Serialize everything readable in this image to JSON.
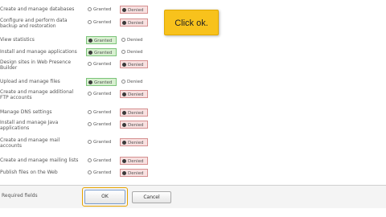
{
  "permissions": [
    {
      "label": "Create and manage databases",
      "granted": "Granted",
      "denied": "Denied",
      "selected": "denied"
    },
    {
      "label": "Configure and perform data\nbackup and restoration",
      "granted": "Granted",
      "denied": "Denied",
      "selected": "denied"
    },
    {
      "label": "View statistics",
      "granted": "Granted",
      "denied": "Denied",
      "selected": "granted"
    },
    {
      "label": "Install and manage applications",
      "granted": "Granted",
      "denied": "Denied",
      "selected": "granted"
    },
    {
      "label": "Design sites in Web Presence\nBuilder",
      "granted": "Granted",
      "denied": "Denied",
      "selected": "denied"
    },
    {
      "label": "Upload and manage files",
      "granted": "Granted",
      "denied": "Denied",
      "selected": "granted"
    },
    {
      "label": "Create and manage additional\nFTP accounts",
      "granted": "Granted",
      "denied": "Denied",
      "selected": "denied"
    },
    {
      "label": "Manage DNS settings",
      "granted": "Granted",
      "denied": "Denied",
      "selected": "denied"
    },
    {
      "label": "Install and manage Java\napplications",
      "granted": "Granted",
      "denied": "Denied",
      "selected": "denied"
    },
    {
      "label": "Create and manage mail\naccounts",
      "granted": "Granted",
      "denied": "Denied",
      "selected": "denied"
    },
    {
      "label": "Create and manage mailing lists",
      "granted": "Granted",
      "denied": "Denied",
      "selected": "denied"
    },
    {
      "label": "Publish files on the Web",
      "granted": "Granted",
      "denied": "Denied",
      "selected": "denied"
    }
  ],
  "callout": {
    "text": "Click ok."
  },
  "footer": {
    "required_label": "Required fields",
    "ok_label": "OK",
    "cancel_label": "Cancel"
  },
  "colors": {
    "granted_bg": "#d8f0d0",
    "denied_bg": "#f8e0e0",
    "callout": "#f8c21c",
    "ok_highlight": "#e7a300"
  }
}
